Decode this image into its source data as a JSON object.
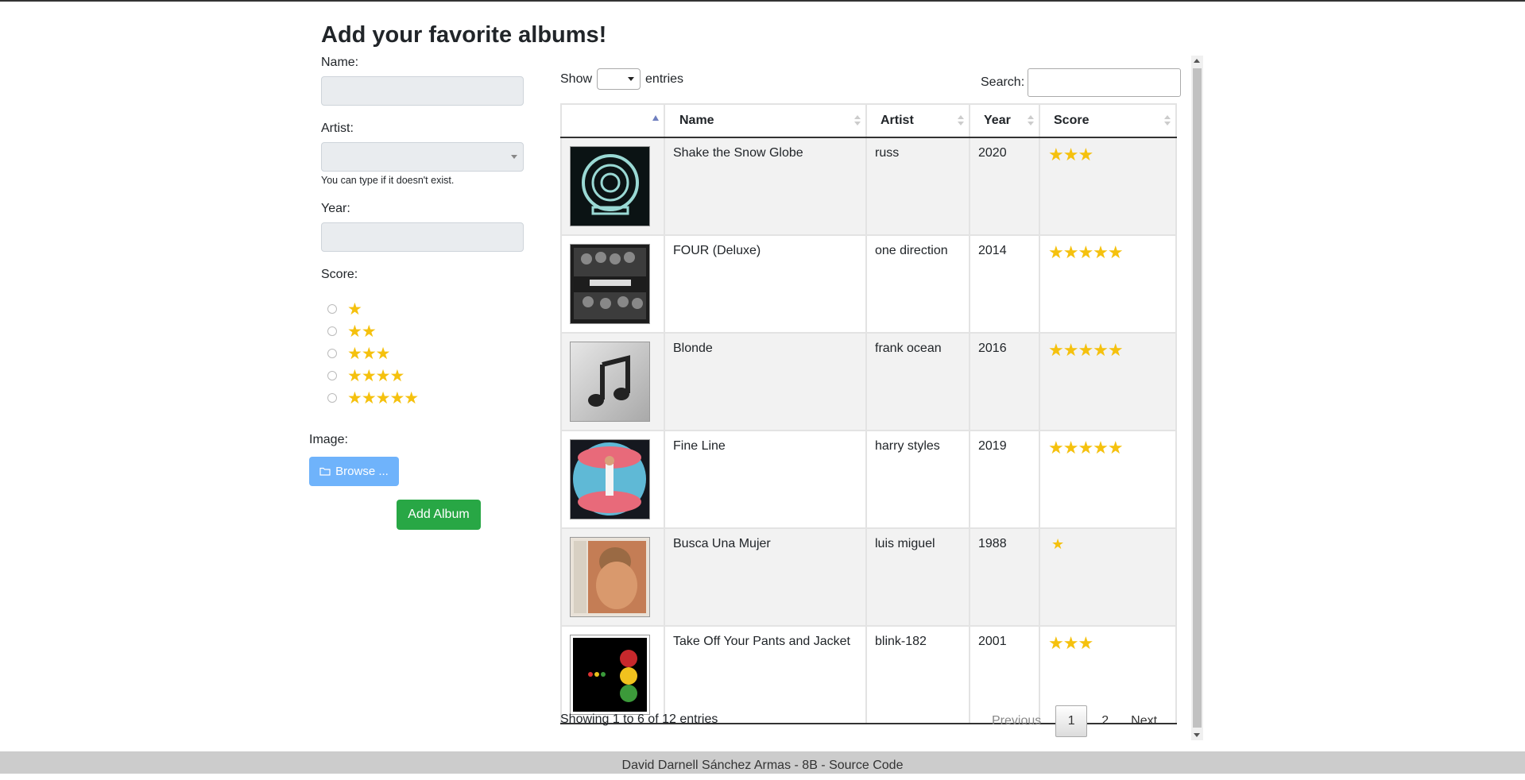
{
  "page": {
    "title": "Add your favorite albums!"
  },
  "form": {
    "name_label": "Name:",
    "name_value": "",
    "artist_label": "Artist:",
    "artist_help": "You can type if it doesn't exist.",
    "year_label": "Year:",
    "year_value": "",
    "score_label": "Score:",
    "score_options": [
      {
        "stars": "★",
        "value": 1
      },
      {
        "stars": "★★",
        "value": 2
      },
      {
        "stars": "★★★",
        "value": 3
      },
      {
        "stars": "★★★★",
        "value": 4
      },
      {
        "stars": "★★★★★",
        "value": 5
      }
    ],
    "image_label": "Image:",
    "browse_label": "Browse ...",
    "add_label": "Add Album"
  },
  "table_controls": {
    "show_label": "Show",
    "entries_label": "entries",
    "search_label": "Search:",
    "search_value": ""
  },
  "table": {
    "columns": [
      "",
      "Name",
      "Artist",
      "Year",
      "Score"
    ],
    "rows": [
      {
        "cover": "cover-shake-the-snow-globe",
        "name": "Shake the Snow Globe",
        "artist": "russ",
        "year": "2020",
        "score": "★★★"
      },
      {
        "cover": "cover-four-deluxe",
        "name": "FOUR (Deluxe)",
        "artist": "one direction",
        "year": "2014",
        "score": "★★★★★"
      },
      {
        "cover": "cover-blonde",
        "name": "Blonde",
        "artist": "frank ocean",
        "year": "2016",
        "score": "★★★★★"
      },
      {
        "cover": "cover-fine-line",
        "name": "Fine Line",
        "artist": "harry styles",
        "year": "2019",
        "score": "★★★★★"
      },
      {
        "cover": "cover-busca-una-mujer",
        "name": "Busca Una Mujer",
        "artist": "luis miguel",
        "year": "1988",
        "score": "★"
      },
      {
        "cover": "cover-take-off-your-pants",
        "name": "Take Off Your Pants and Jacket",
        "artist": "blink-182",
        "year": "2001",
        "score": "★★★"
      }
    ]
  },
  "pagination": {
    "info": "Showing 1 to 6 of 12 entries",
    "previous": "Previous",
    "pages": [
      "1",
      "2"
    ],
    "next": "Next"
  },
  "footer": {
    "text": "David Darnell Sánchez Armas - 8B - Source Code"
  },
  "colors": {
    "star": "#f5c10e",
    "browse_button": "#6fb3fb",
    "add_button": "#28a745"
  }
}
